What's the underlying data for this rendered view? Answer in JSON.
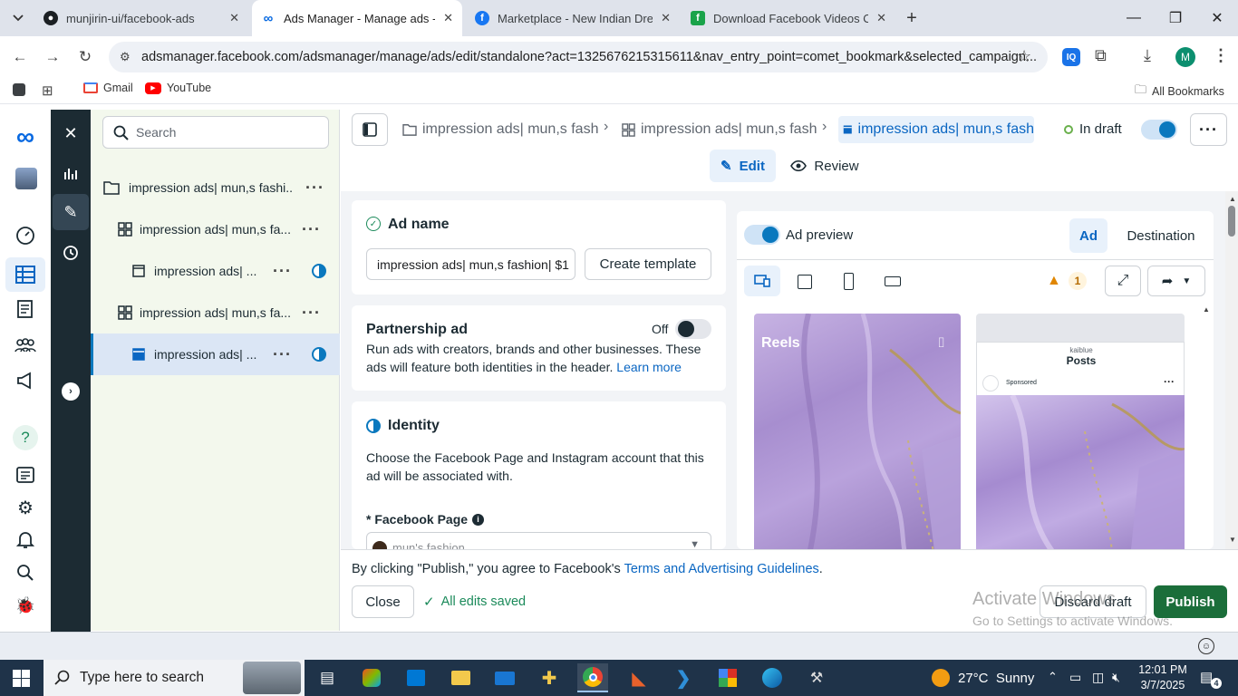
{
  "browser": {
    "tabs": [
      {
        "title": "munjirin-ui/facebook-ads",
        "icon": "github-icon",
        "active": false
      },
      {
        "title": "Ads Manager - Manage ads - A",
        "icon": "meta-icon",
        "active": true
      },
      {
        "title": "Marketplace - New Indian Dres",
        "icon": "facebook-icon",
        "active": false
      },
      {
        "title": "Download Facebook Videos On",
        "icon": "facebook-green-icon",
        "active": false
      }
    ],
    "url": "adsmanager.facebook.com/adsmanager/manage/ads/edit/standalone?act=1325676215315611&nav_entry_point=comet_bookmark&selected_campaign...",
    "profile_initial": "M",
    "bookmarks": [
      {
        "label": "Gmail",
        "icon": "gmail-icon"
      },
      {
        "label": "YouTube",
        "icon": "youtube-icon"
      }
    ],
    "all_bookmarks_label": "All Bookmarks"
  },
  "tree": {
    "search_placeholder": "Search",
    "rows": [
      {
        "label": "impression ads| mun,s fashi...",
        "type": "campaign",
        "selected": false
      },
      {
        "label": "impression ads| mun,s fa...",
        "type": "adset",
        "selected": false
      },
      {
        "label": "impression ads| ...",
        "type": "ad",
        "selected": false
      },
      {
        "label": "impression ads| mun,s fa...",
        "type": "adset",
        "selected": false
      },
      {
        "label": "impression ads| ...",
        "type": "ad",
        "selected": true
      }
    ]
  },
  "header": {
    "crumbs": [
      "impression ads| mun,s fash",
      "impression ads| mun,s fash",
      "impression ads| mun,s fash"
    ],
    "status": "In draft",
    "tabs": [
      "Edit",
      "Review"
    ]
  },
  "ad_name": {
    "title": "Ad name",
    "value": "impression ads| mun,s fashion| $1",
    "create_template": "Create template"
  },
  "partnership": {
    "title": "Partnership ad",
    "toggle_label": "Off",
    "text": "Run ads with creators, brands and other businesses. These ads will feature both identities in the header.",
    "link": "Learn more"
  },
  "identity": {
    "title": "Identity",
    "text": "Choose the Facebook Page and Instagram account that this ad will be associated with.",
    "fb_page_label": "* Facebook Page",
    "fb_page_value": "mun's fashion"
  },
  "preview": {
    "title": "Ad preview",
    "tabs": [
      "Ad",
      "Destination"
    ],
    "warning_count": "1",
    "reels_label": "Reels",
    "posts_brand": "kaiblue",
    "posts_label": "Posts",
    "sponsored_label": "Sponsored"
  },
  "footer": {
    "consent_prefix": "By clicking \"Publish,\" you agree to Facebook's",
    "consent_link": "Terms and Advertising Guidelines",
    "consent_suffix": ".",
    "close": "Close",
    "saved": "All edits saved",
    "discard": "Discard draft",
    "publish": "Publish",
    "watermark_title": "Activate Windows",
    "watermark_sub": "Go to Settings to activate Windows."
  },
  "taskbar": {
    "search_placeholder": "Type here to search",
    "weather": "27°C  Sunny",
    "time": "12:01 PM",
    "date": "3/7/2025",
    "notifications": "4"
  },
  "colors": {
    "primary": "#0a78be",
    "publish": "#1b6e3a",
    "dark_sidebar": "#1c2b33",
    "tree_bg": "#f3f8ed"
  }
}
